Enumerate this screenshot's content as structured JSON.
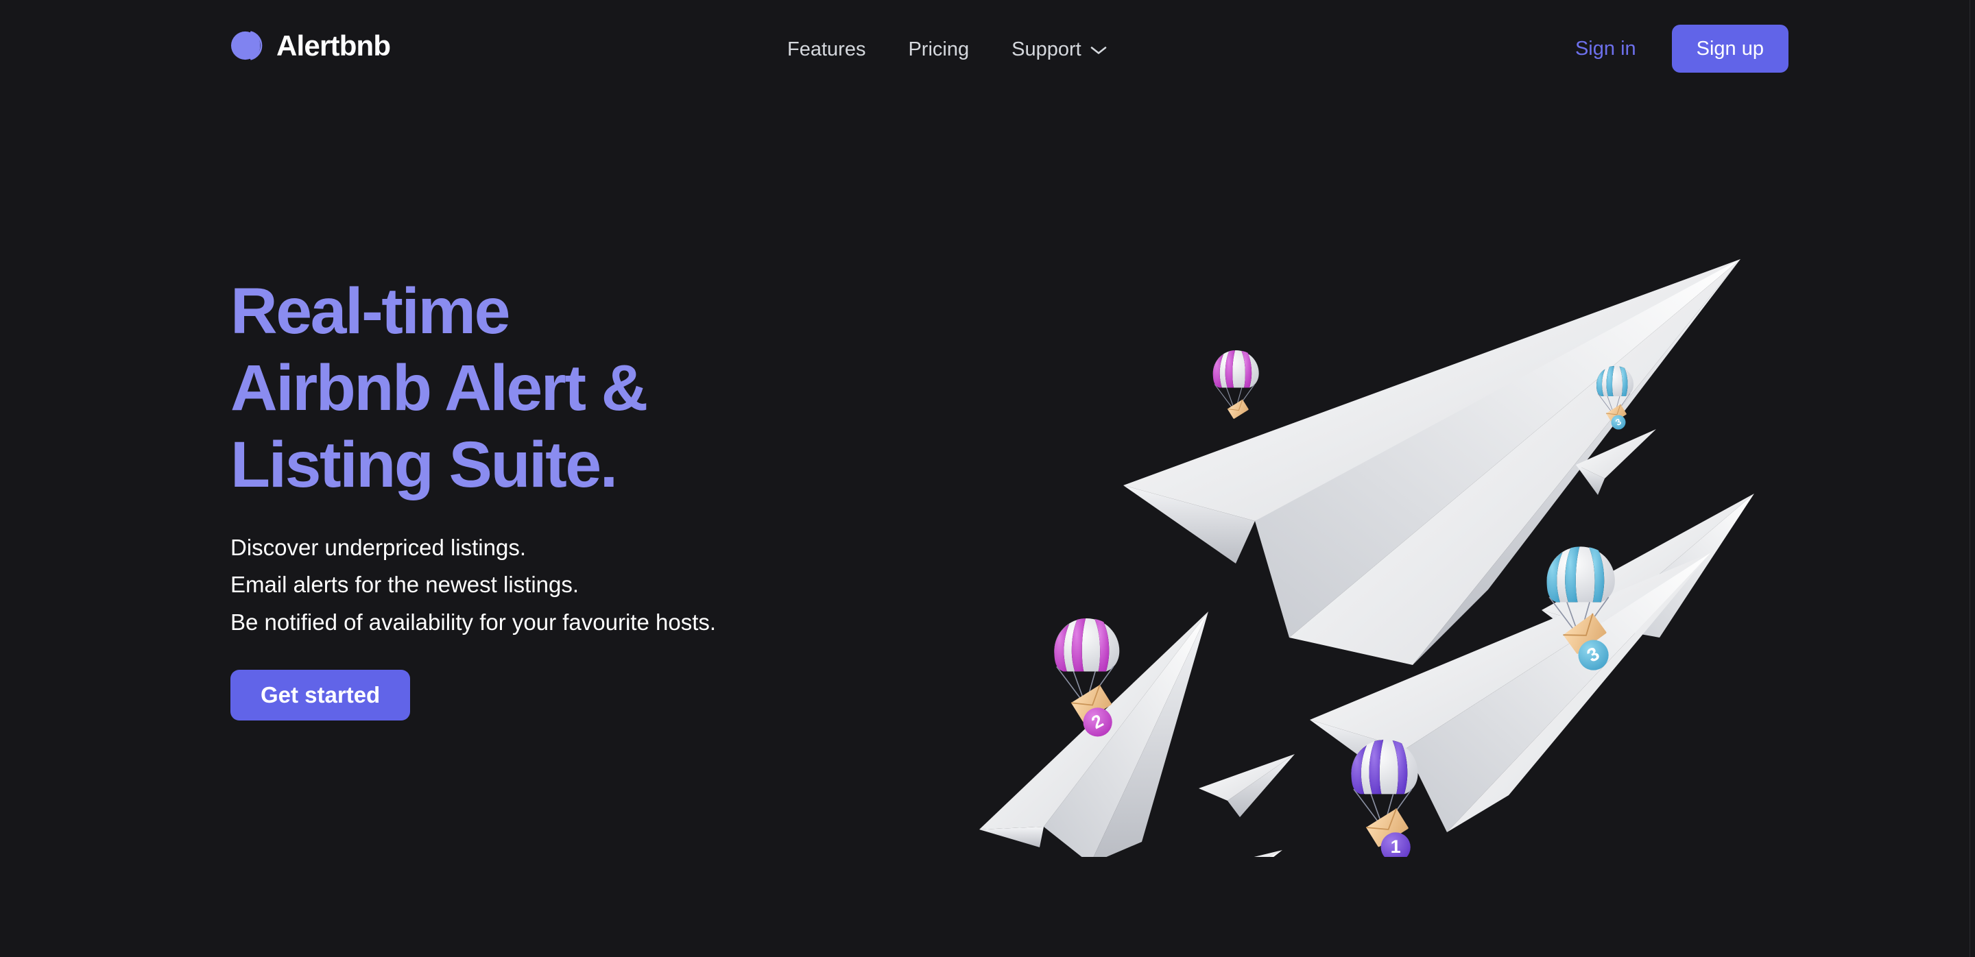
{
  "theme": {
    "background": "#161619",
    "accent": "#6164e8",
    "accent_light": "#8a8cf0",
    "text": "#ffffff",
    "nav_text": "#d5d8dd"
  },
  "header": {
    "brand": {
      "name": "Alertbnb",
      "logo_icon": "crescent-moon-icon"
    },
    "nav": [
      {
        "label": "Features",
        "icon": null
      },
      {
        "label": "Pricing",
        "icon": null
      },
      {
        "label": "Support",
        "icon": "chevron-down-icon"
      }
    ],
    "actions": {
      "signin_label": "Sign in",
      "signup_label": "Sign up"
    }
  },
  "hero": {
    "title_lines": [
      "Real-time",
      "Airbnb Alert &",
      "Listing Suite."
    ],
    "subtitle_lines": [
      "Discover underpriced listings.",
      "Email alerts for the newest listings.",
      "Be notified of availability for your favourite hosts."
    ],
    "cta_label": "Get started",
    "illustration": {
      "name": "paper-planes-parachute-mail-illustration",
      "parachutes": [
        {
          "color": "#c13cc4",
          "badge": null
        },
        {
          "color": "#4db3d8",
          "badge": "3"
        },
        {
          "color": "#c13cc4",
          "badge": "2"
        },
        {
          "color": "#4db3d8",
          "badge": "3"
        },
        {
          "color": "#6f44d6",
          "badge": "1"
        }
      ],
      "plane_count": 7
    }
  }
}
